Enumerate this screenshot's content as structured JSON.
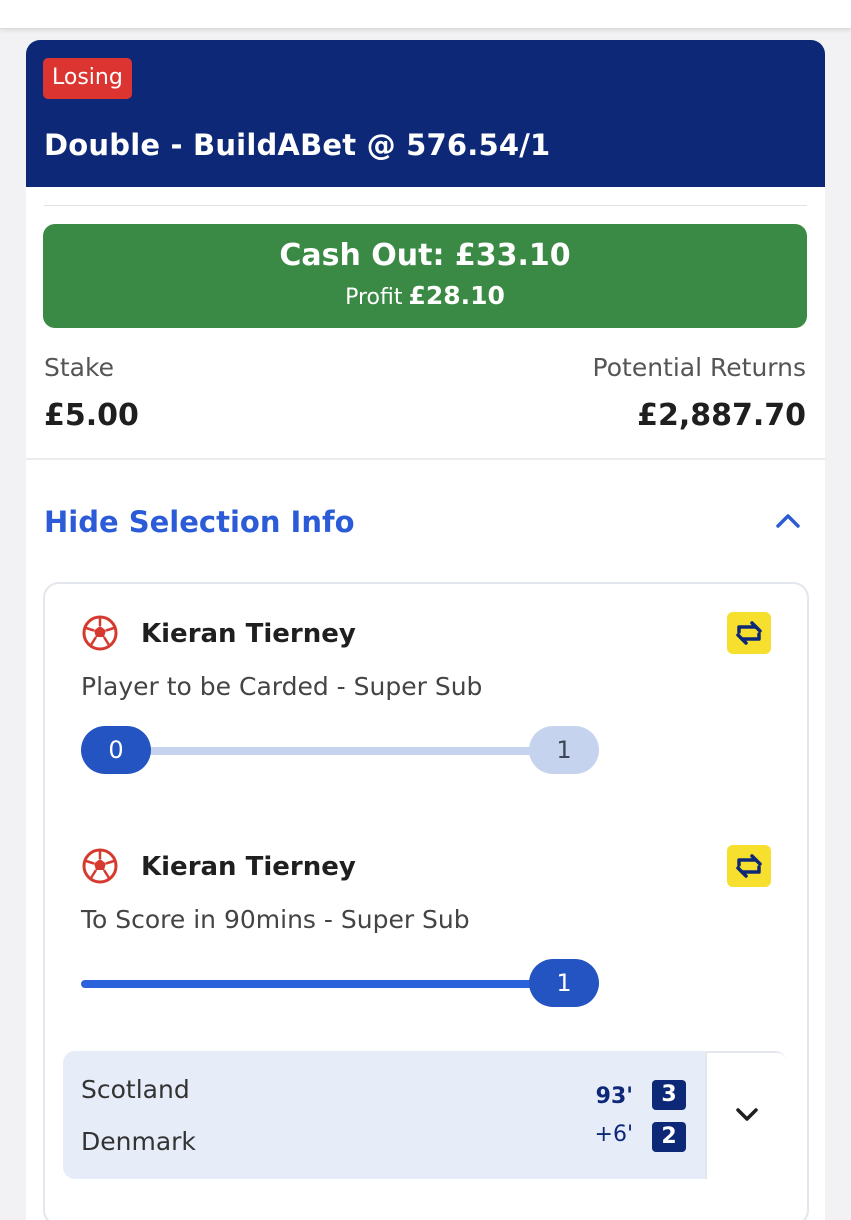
{
  "status_badge": "Losing",
  "bet_title": "Double - BuildABet @ 576.54/1",
  "cashout": {
    "label": "Cash Out: £33.10",
    "profit_label": "Profit",
    "profit_value": "£28.10"
  },
  "stake": {
    "label": "Stake",
    "value": "£5.00"
  },
  "returns": {
    "label": "Potential Returns",
    "value": "£2,887.70"
  },
  "selection_toggle": "Hide Selection Info",
  "selections": [
    {
      "player": "Kieran Tierney",
      "market": "Player to be Carded - Super Sub",
      "progress": {
        "current": "0",
        "target": "1",
        "fraction": 0
      }
    },
    {
      "player": "Kieran Tierney",
      "market": "To Score in 90mins - Super Sub",
      "progress": {
        "target": "1",
        "fraction": 1
      }
    }
  ],
  "match": {
    "home": "Scotland",
    "away": "Denmark",
    "minute": "93'",
    "added_time": "+6'",
    "home_score": "3",
    "away_score": "2"
  },
  "colors": {
    "header": "#0e2878",
    "losing": "#dc3430",
    "cashout": "#3a8a45",
    "link": "#2b5bd7",
    "progress": "#2453c2",
    "swap_icon_bg": "#f6df2d"
  },
  "icons": [
    "football-icon",
    "swap-icon",
    "chevron-up-icon",
    "chevron-down-icon"
  ]
}
